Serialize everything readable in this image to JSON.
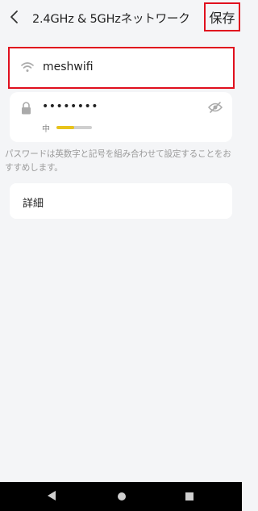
{
  "header": {
    "title": "2.4GHz & 5GHzネットワーク",
    "save_label": "保存",
    "back_icon": "chevron-left-icon"
  },
  "ssid": {
    "value": "meshwifi",
    "icon": "wifi-icon"
  },
  "password": {
    "value": "••••••••",
    "icon": "lock-icon",
    "toggle_icon": "eye-off-icon",
    "strength_label": "中",
    "strength_fraction": 0.5,
    "strength_color": "#e8c31b"
  },
  "hint": "パスワードは英数字と記号を組み合わせて設定することをおすすめします。",
  "details": {
    "label": "詳細"
  },
  "colors": {
    "highlight": "#e0101e",
    "background": "#f4f5f7"
  },
  "navbar": {
    "back_icon": "nav-back-icon",
    "home_icon": "nav-home-icon",
    "recents_icon": "nav-recents-icon"
  }
}
